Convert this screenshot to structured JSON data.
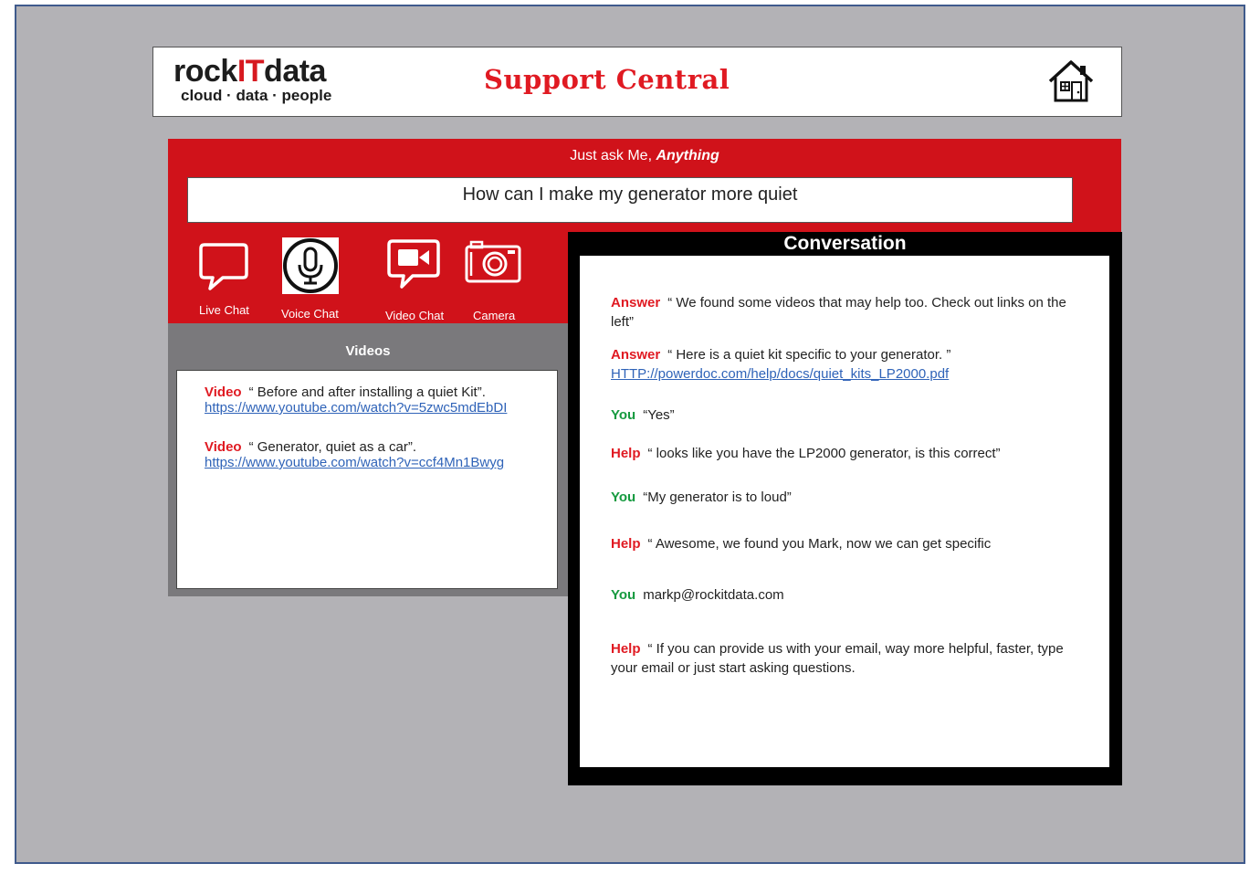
{
  "header": {
    "logo_prefix": "rock",
    "logo_it": "IT",
    "logo_suffix": "data",
    "logo_tagline": "cloud · data · people",
    "title": "Support Central",
    "home_icon": "home-icon"
  },
  "ask": {
    "prompt": "Just ask Me, ",
    "prompt_emphasis": "Anything",
    "query": "How can I make my generator more quiet"
  },
  "tools": [
    {
      "label": "Live Chat",
      "icon": "speech-bubble-icon"
    },
    {
      "label": "Voice Chat",
      "icon": "microphone-icon"
    },
    {
      "label": "Video Chat",
      "icon": "video-camera-icon"
    },
    {
      "label": "Camera",
      "icon": "camera-icon"
    }
  ],
  "videos": {
    "title": "Videos",
    "items": [
      {
        "tag": "Video",
        "text": "“ Before and after installing a quiet Kit”.",
        "url": "https://www.youtube.com/watch?v=5zwc5mdEbDI"
      },
      {
        "tag": "Video",
        "text": "“ Generator, quiet as a car”.",
        "url": "https://www.youtube.com/watch?v=ccf4Mn1Bwyg"
      }
    ]
  },
  "conversation": {
    "title": "Conversation",
    "messages": [
      {
        "speaker": "Answer",
        "text": "“ We found some videos that may help too. Check out links on the left”"
      },
      {
        "speaker": "Answer",
        "text": "“ Here is a quiet kit specific to your generator. ”",
        "link": "HTTP://powerdoc.com/help/docs/quiet_kits_LP2000.pdf"
      },
      {
        "speaker": "You",
        "text": "“Yes”"
      },
      {
        "speaker": "Help",
        "text": "“ looks like you have the LP2000 generator, is this correct”"
      },
      {
        "speaker": "You",
        "text": "“My generator is to loud”"
      },
      {
        "speaker": "Help",
        "text": "“ Awesome, we found you Mark, now we can get specific"
      },
      {
        "speaker": "You",
        "text": "markp@rockitdata.com"
      },
      {
        "speaker": "Help",
        "text": "“ If you can provide us with your email, way more helpful, faster, type your email or just start asking questions."
      }
    ]
  },
  "colors": {
    "brand_red": "#d0121a",
    "speaker_red": "#e01a22",
    "speaker_green": "#159a3f",
    "link_blue": "#2f63b8",
    "background_gray": "#b3b2b6"
  }
}
